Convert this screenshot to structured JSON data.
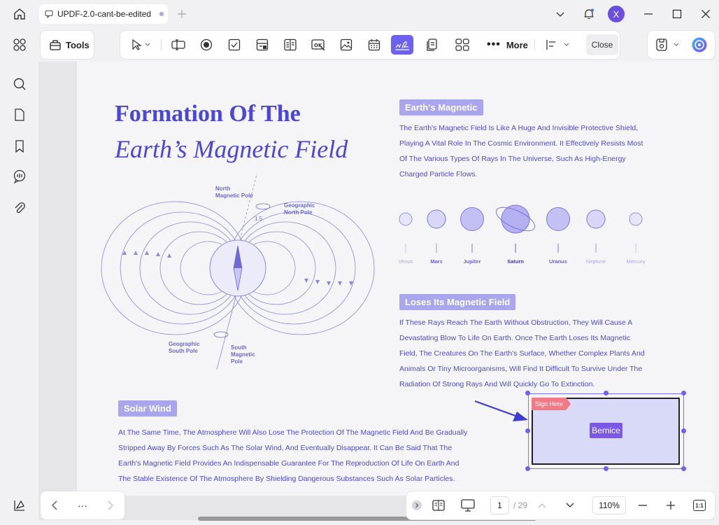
{
  "titlebar": {
    "tab_title": "UPDF-2.0-cant-be-edited",
    "avatar_letter": "X"
  },
  "toolbar": {
    "tools_label": "Tools",
    "more_label": "More",
    "close_label": "Close"
  },
  "document": {
    "title_line1": "Formation Of The",
    "title_line2": "Earth’s Magnetic Field",
    "sections": [
      {
        "heading": "Earth's Magnetic",
        "lines": [
          "The Earth's Magnetic Field Is Like A Huge And Invisible Protective Shield,",
          "Playing A Vital Role In The Cosmic Environment. It Effectively Resists Most",
          "Of The Various Types Of Rays In The Universe, Such As High-Energy",
          "Charged Particle Flows."
        ]
      },
      {
        "heading": "Loses Its Magnetic Field",
        "lines": [
          "If These Rays Reach The Earth Without Obstruction, They Will Cause A",
          "Devastating Blow To Life On Earth. Once The Earth Loses Its Magnetic",
          "Field, The Creatures On The Earth's Surface, Whether Complex Plants And",
          "Animals Or Tiny Microorganisms, Will Find It Difficult To Survive Under The",
          "Radiation Of Strong Rays And Will Quickly Go To Extinction."
        ]
      },
      {
        "heading": "Solar Wind",
        "lines": [
          "At The Same Time, The Atmosphere Will Also Lose The Protection Of The Magnetic Field And Be Gradually",
          "Stripped Away By Forces Such As The Solar Wind, And Eventually Disappear. It Can Be Said That The",
          "Earth's Magnetic Field Provides An Indispensable Guarantee For The Reproduction Of Life On Earth And",
          "The Stable Existence Of The Atmosphere By Shielding Dangerous Substances Such As Solar Particles."
        ]
      }
    ],
    "planets": [
      "Venus",
      "Mars",
      "Jupiter",
      "Saturn",
      "Uranus",
      "Neptune",
      "Mercury"
    ],
    "diagram": {
      "north_magnetic": [
        "North",
        "Magnetic Pole"
      ],
      "geo_north": [
        "Geographic",
        "North Pole"
      ],
      "angle": "1.5",
      "geo_south": [
        "Geographic",
        "South Pole"
      ],
      "south_magnetic": [
        "South",
        "Magnetic",
        "Pole"
      ]
    },
    "signature": {
      "sign_here": "Sign Here",
      "signer": "Bernice"
    }
  },
  "pagination": {
    "current_page": "1",
    "total": "/ 29",
    "zoom": "110%",
    "fit_label": "1:1"
  },
  "colors": {
    "accent": "#6d62f0",
    "doc_text": "#4f4bd6",
    "tag_bg": "#aaa6ee",
    "sign_tag": "#f07a86",
    "signer_bg": "#7c58e6"
  }
}
